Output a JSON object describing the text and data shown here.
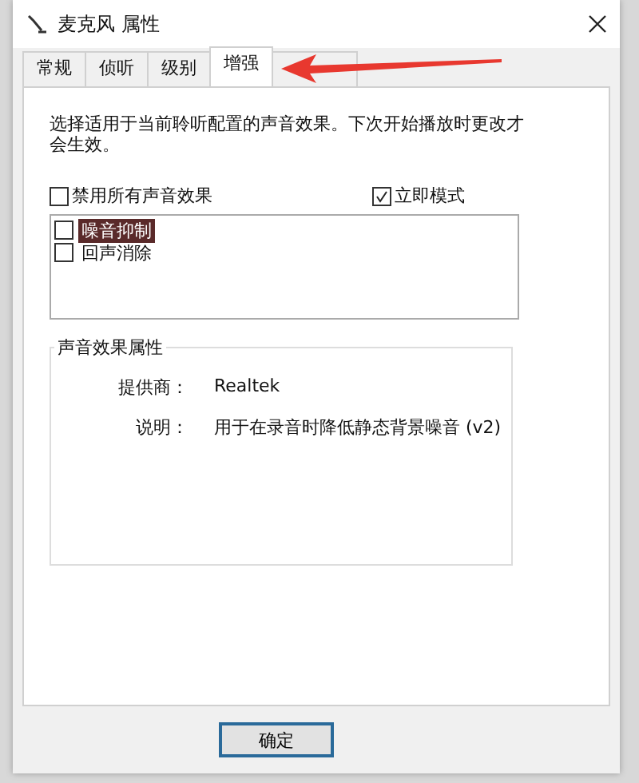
{
  "window": {
    "title": "麦克风 属性"
  },
  "tabs": [
    {
      "label": "常规",
      "selected": false
    },
    {
      "label": "侦听",
      "selected": false
    },
    {
      "label": "级别",
      "selected": false
    },
    {
      "label": "增强",
      "selected": true
    }
  ],
  "description": "选择适用于当前聆听配置的声音效果。下次开始播放时更改才会生效。",
  "disable_all": {
    "label": "禁用所有声音效果",
    "checked": false
  },
  "immediate_mode": {
    "label": "立即模式",
    "checked": true
  },
  "effects": [
    {
      "label": "噪音抑制",
      "checked": false,
      "selected": true
    },
    {
      "label": "回声消除",
      "checked": false,
      "selected": false
    }
  ],
  "properties": {
    "title": "声音效果属性",
    "rows": [
      {
        "label": "提供商：",
        "value": "Realtek"
      },
      {
        "label": "说明：",
        "value": "用于在录音时降低静态背景噪音 (v2)"
      }
    ]
  },
  "buttons": [
    "确定"
  ]
}
